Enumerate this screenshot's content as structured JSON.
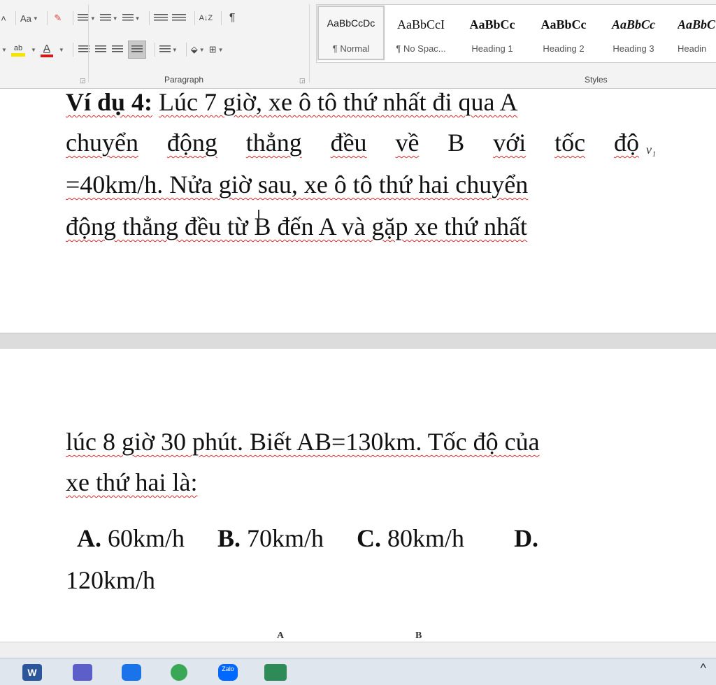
{
  "ribbon": {
    "font_row": {
      "font_size_case": "Aa",
      "highlight_label": "ab",
      "font_color_label": "A"
    },
    "paragraph": {
      "group_label": "Paragraph",
      "sort_label": "A↓Z",
      "pilcrow": "¶"
    },
    "styles": {
      "group_label": "Styles",
      "items": [
        {
          "preview": "AaBbCcDc",
          "name": "¶ Normal"
        },
        {
          "preview": "AaBbCcI",
          "name": "¶ No Spac..."
        },
        {
          "preview": "AaBbCc",
          "name": "Heading 1"
        },
        {
          "preview": "AaBbCc",
          "name": "Heading 2"
        },
        {
          "preview": "AaBbCc",
          "name": "Heading 3"
        },
        {
          "preview": "AaBbC",
          "name": "Headin"
        }
      ]
    }
  },
  "document": {
    "line1_label": "Ví dụ 4:",
    "line1_text": "Lúc 7 giờ, xe ô tô thứ nhất đi qua A",
    "line2_words": [
      "chuyển",
      "động",
      "thẳng",
      "đều",
      "về",
      "B",
      "với",
      "tốc",
      "độ"
    ],
    "margin_mark": "v₁",
    "line3": "=40km/h. Nửa giờ sau, xe ô tô thứ hai chuyển",
    "line4": "động thẳng đều từ B đến A và gặp xe thứ nhất",
    "line5": "lúc 8 giờ 30 phút. Biết AB=130km. Tốc độ của",
    "line6": "xe thứ hai là:",
    "options": [
      {
        "label": "A.",
        "value": "60km/h"
      },
      {
        "label": "B.",
        "value": "70km/h"
      },
      {
        "label": "C.",
        "value": "80km/h"
      },
      {
        "label": "D.",
        "value": ""
      }
    ],
    "option_d_value": "120km/h",
    "faint_a": "A",
    "faint_b": "B"
  },
  "taskbar": {
    "apps": [
      "word-icon",
      "teams-icon",
      "video-icon",
      "chrome-icon",
      "zalo-icon",
      "files-icon"
    ],
    "zalo_text": "Zalo",
    "word_text": "W",
    "chevron": "^"
  },
  "colors": {
    "spell_underline": "#d42a2a",
    "highlight": "#f5e400",
    "font_color": "#d11b1b",
    "taskbar": "#dfe6ee"
  }
}
